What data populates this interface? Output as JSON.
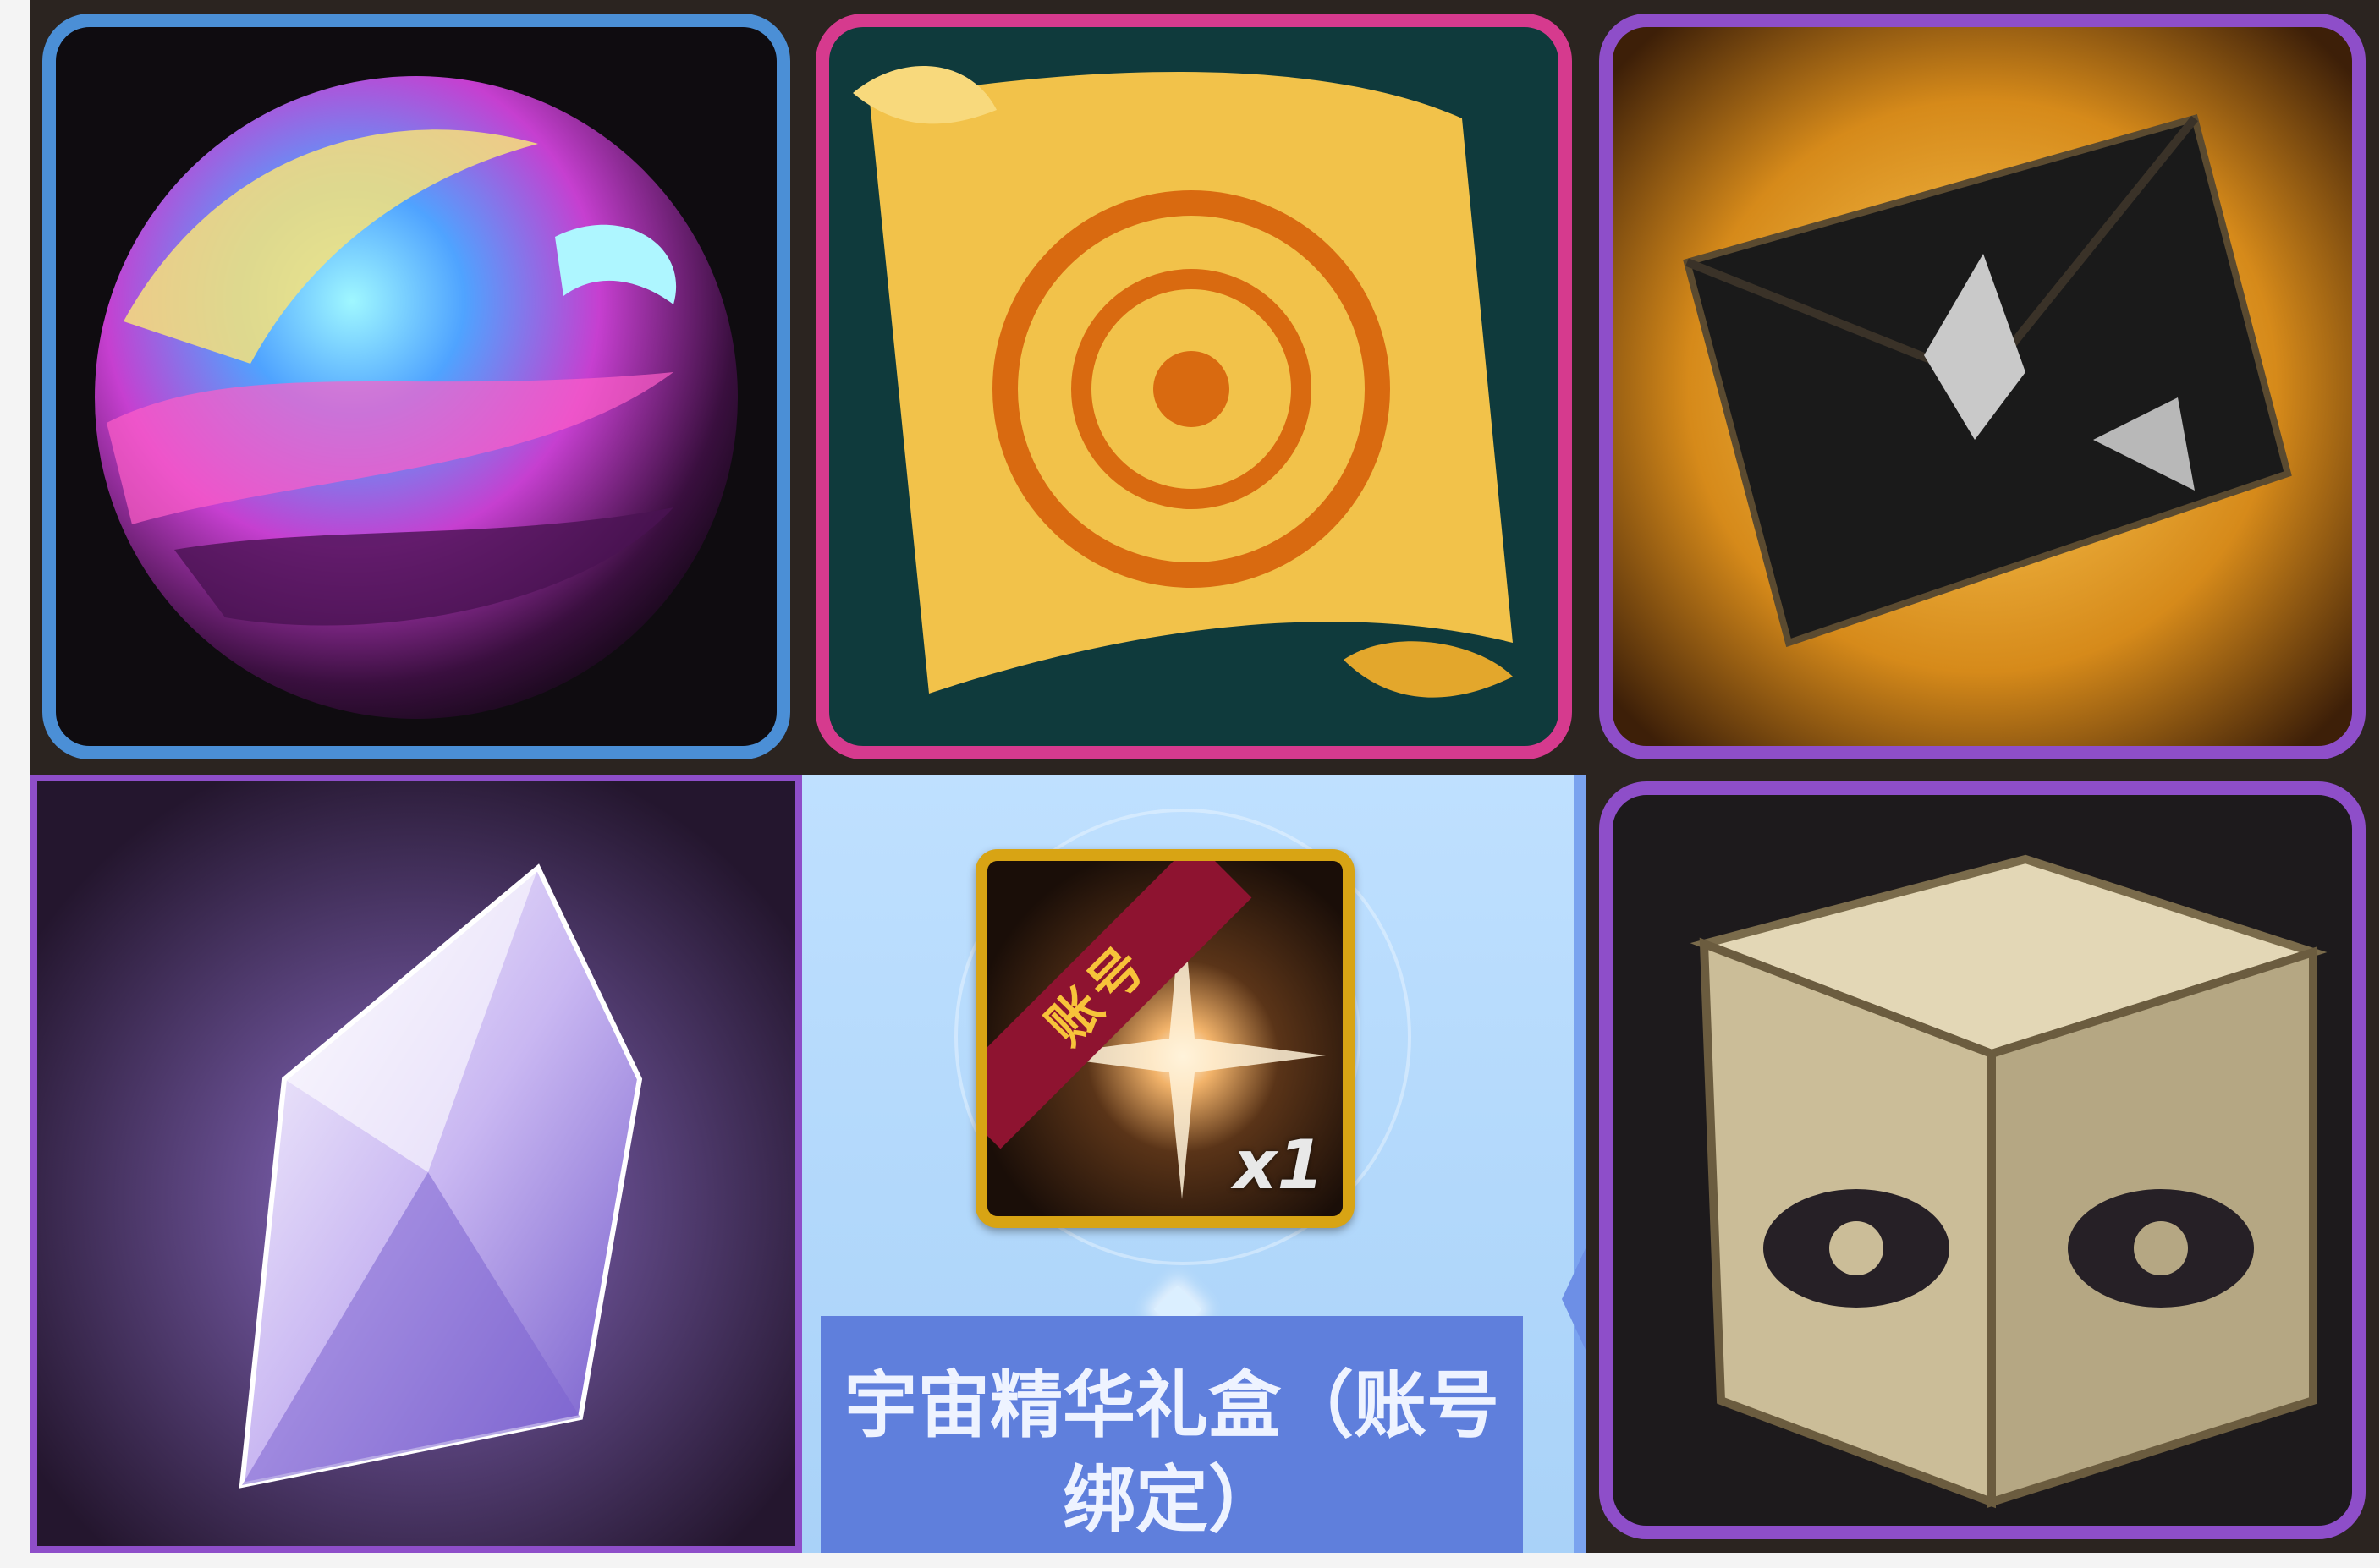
{
  "items": [
    {
      "name": "purple-orb-icon",
      "frame_color": "#4b8fd6"
    },
    {
      "name": "golden-scroll-icon",
      "frame_color": "#d63a8e"
    },
    {
      "name": "dark-envelope-icon",
      "frame_color": "#8e4ec9"
    },
    {
      "name": "purple-crystal-icon",
      "frame_color": "#8e4ec9"
    },
    {
      "name": "silver-cube-icon",
      "frame_color": "#8e4ec9"
    }
  ],
  "featured": {
    "bind_badge": "账号",
    "quantity": "x1",
    "name_line1": "宇宙精华礼盒（账号",
    "name_line2": "绑定）"
  }
}
